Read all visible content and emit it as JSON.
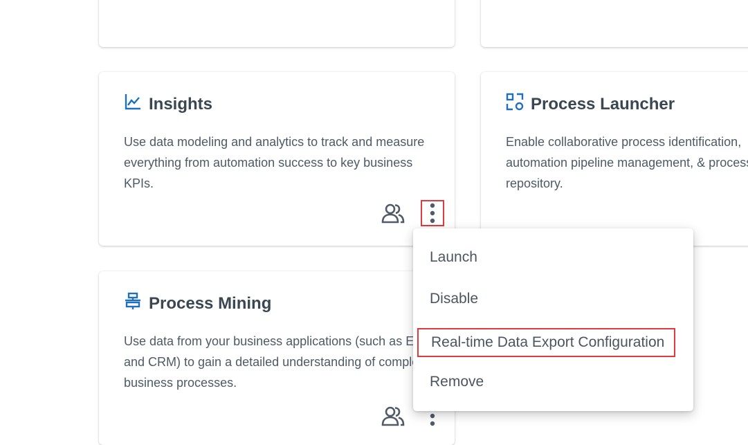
{
  "cards": {
    "insights": {
      "title": "Insights",
      "description": "Use data modeling and analytics to track and measure everything from automation success to key business KPIs.",
      "icon": "line-chart-icon"
    },
    "process_launcher": {
      "title": "Process Launcher",
      "description": "Enable collaborative process identification, automation pipeline management, & process repository.",
      "icon": "process-launcher-icon"
    },
    "process_mining": {
      "title": "Process Mining",
      "description": "Use data from your business applications (such as ERP and CRM) to gain a detailed understanding of complex business processes.",
      "icon": "process-mining-icon"
    }
  },
  "context_menu": {
    "items": [
      "Launch",
      "Disable",
      "Real-time Data Export Configuration",
      "Remove"
    ]
  },
  "colors": {
    "accent": "#1f6fbf",
    "highlight": "#e0393e",
    "icon_gray": "#4f5b66"
  }
}
